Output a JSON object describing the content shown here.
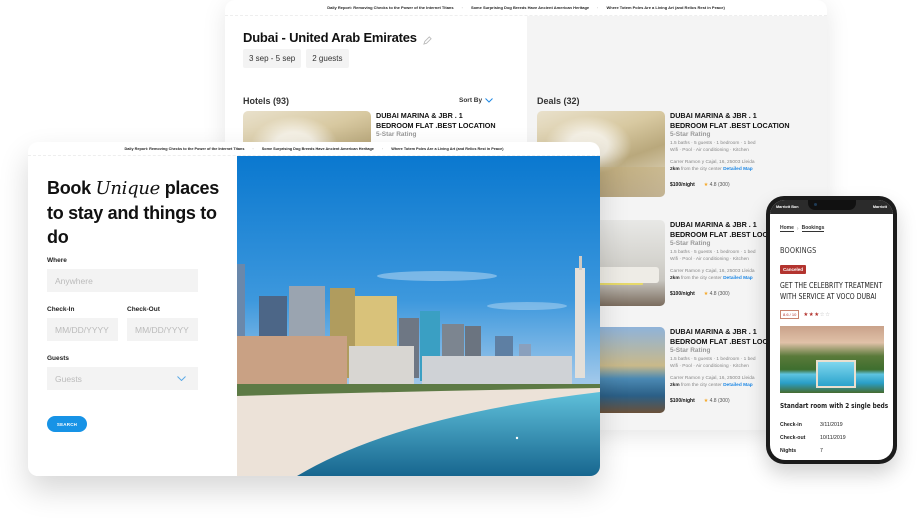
{
  "news_ticker": [
    "Daily Report: Removing Checks to the Power of the Internet Titans",
    "Some Surprising Dog Breeds Have Ancient American Heritage",
    "Where Totem Poles Are a Living Art (and Relics Rest in Peace)"
  ],
  "results_page": {
    "city_title": "Dubai - United Arab Emirates",
    "dates_chip": "3 sep - 5 sep",
    "guests_chip": "2 guests",
    "hotels_heading": "Hotels (93)",
    "sort_label": "Sort By",
    "deals_heading": "Deals (32)",
    "hotel_card": {
      "name": "DUBAI MARINA & JBR . 1 BEDROOM FLAT .BEST LOCATION",
      "rating_label": "5-Star Rating"
    },
    "deals": [
      {
        "name": "DUBAI MARINA & JBR . 1 BEDROOM FLAT .BEST LOCATION",
        "rating_label": "5-Star Rating",
        "amenities_line1": "1.5 baths · 5 guests · 1 bedroom · 1 bed",
        "amenities_line2": "Wifi · Pool · Air conditioning · Kitchen",
        "address": "Carrer Ramon y Cajal, 16, 25003 Lleida",
        "distance": "2km",
        "distance_suffix": "from the city center",
        "map_link": "Detailed Map",
        "price": "$100/night",
        "rating": "4.8 (300)"
      },
      {
        "name": "DUBAI MARINA & JBR . 1 BEDROOM FLAT .BEST LOCATION",
        "rating_label": "5-Star Rating",
        "amenities_line1": "1.5 baths · 5 guests · 1 bedroom · 1 bed",
        "amenities_line2": "Wifi · Pool · Air conditioning · Kitchen",
        "address": "Carrer Ramon y Cajal, 16, 25003 Lleida",
        "distance": "2km",
        "distance_suffix": "from the city center",
        "map_link": "Detailed Map",
        "price": "$100/night",
        "rating": "4.8 (300)"
      },
      {
        "name": "DUBAI MARINA & JBR . 1 BEDROOM FLAT .BEST LOCATION",
        "rating_label": "5-Star Rating",
        "amenities_line1": "1.5 baths · 5 guests · 1 bedroom · 1 bed",
        "amenities_line2": "Wifi · Pool · Air conditioning · Kitchen",
        "address": "Carrer Ramon y Cajal, 16, 25003 Lleida",
        "distance": "2km",
        "distance_suffix": "from the city center",
        "map_link": "Detailed Map",
        "price": "$100/night",
        "rating": "4.8 (300)"
      }
    ]
  },
  "booking_page": {
    "title_before": "Book ",
    "title_emphasis": "Unique",
    "title_after": " places to stay and things to do",
    "where_label": "Where",
    "where_placeholder": "Anywhere",
    "checkin_label": "Check-In",
    "checkin_placeholder": "MM/DD/YYYY",
    "checkout_label": "Check-Out",
    "checkout_placeholder": "MM/DD/YYYY",
    "guests_label": "Guests",
    "guests_placeholder": "Guests",
    "search_button": "SEARCH"
  },
  "phone": {
    "status_left": "Marriott Bon",
    "status_right": "Marriott",
    "breadcrumb_home": "Home",
    "breadcrumb_current": "Bookings",
    "heading": "BOOKINGS",
    "status_badge": "Canceled",
    "offer_title": "GET THE CELEBRITY TREATMENT WITH SERVICE AT VOCO DUBAI",
    "score": "8.6 / 10",
    "stars_filled": 3,
    "stars_total": 5,
    "room_title": "Standart room with 2 single beds",
    "details": [
      {
        "key": "Check-in",
        "value": "3/11/2019"
      },
      {
        "key": "Check-out",
        "value": "10/11/2019"
      },
      {
        "key": "Nights",
        "value": "7"
      }
    ]
  },
  "colors": {
    "accent_blue": "#1793e6",
    "link_blue": "#1e88e5",
    "canceled_red": "#b3342f",
    "star_orange": "#f5a623"
  }
}
